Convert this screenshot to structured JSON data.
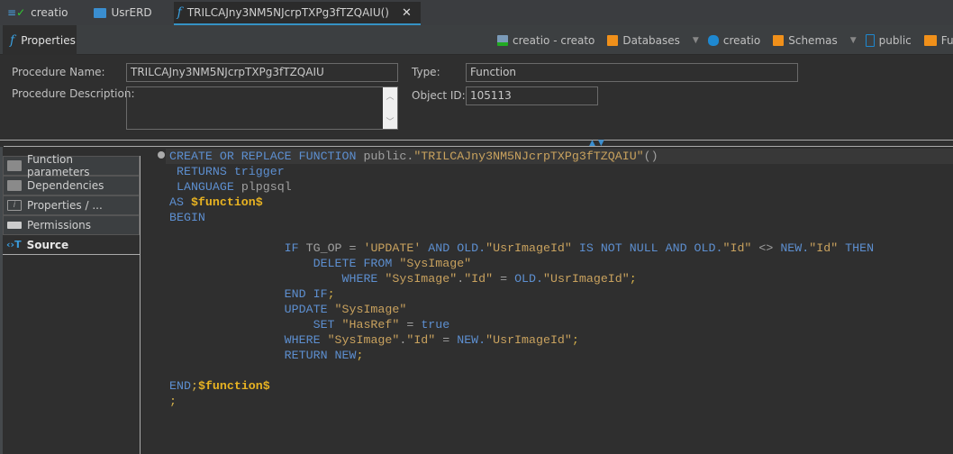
{
  "tabs": [
    {
      "label": "creatio",
      "icon": "connection-check-icon"
    },
    {
      "label": "UsrERD",
      "icon": "erd-icon"
    },
    {
      "label": "TRILCAJny3NM5NJcrpTXPg3fTZQAIU()",
      "icon": "function-icon",
      "active": true
    }
  ],
  "toolbar": {
    "properties_tab": "Properties",
    "breadcrumbs": [
      {
        "label": "creatio - creato",
        "icon": "postgres-connection-icon"
      },
      {
        "label": "Databases",
        "icon": "folder-db-icon",
        "dropdown": true
      },
      {
        "label": "creatio",
        "icon": "database-icon"
      },
      {
        "label": "Schemas",
        "icon": "schemas-icon",
        "dropdown": true
      },
      {
        "label": "public",
        "icon": "schema-icon"
      },
      {
        "label": "Functions",
        "icon": "folder-icon"
      }
    ]
  },
  "form": {
    "name_label": "Procedure Name:",
    "name_value": "TRILCAJny3NM5NJcrpTXPg3fTZQAIU",
    "desc_label": "Procedure Description:",
    "desc_value": "",
    "type_label": "Type:",
    "type_value": "Function",
    "id_label": "Object ID:",
    "id_value": "105113"
  },
  "sidebar": {
    "items": [
      {
        "label": "Function parameters",
        "icon": "table-icon"
      },
      {
        "label": "Dependencies",
        "icon": "folder-icon"
      },
      {
        "label": "Properties / ...",
        "icon": "info-icon"
      },
      {
        "label": "Permissions",
        "icon": "key-icon"
      },
      {
        "label": "Source",
        "icon": "source-icon",
        "active": true
      }
    ]
  },
  "colors": {
    "keyword": "#5d8fd0",
    "string": "#c9a25e",
    "identifier": "#a0a0a0",
    "dollar_quote": "#e8b322",
    "accent": "#3592c4"
  },
  "source": [
    [
      [
        "kw",
        "CREATE OR REPLACE FUNCTION "
      ],
      [
        "pl",
        "public."
      ],
      [
        "str",
        "\"TRILCAJny3NM5NJcrpTXPg3fTZQAIU\""
      ],
      [
        "pl",
        "()"
      ]
    ],
    [
      [
        "pl",
        " "
      ],
      [
        "kw",
        "RETURNS trigger"
      ]
    ],
    [
      [
        "pl",
        " "
      ],
      [
        "kw",
        "LANGUAGE "
      ],
      [
        "pl",
        "plpgsql"
      ]
    ],
    [
      [
        "kw",
        "AS "
      ],
      [
        "fn",
        "$function$"
      ]
    ],
    [
      [
        "kw",
        "BEGIN"
      ]
    ],
    [],
    [
      [
        "pl",
        "                "
      ],
      [
        "kw",
        "IF "
      ],
      [
        "pl",
        "TG_OP = "
      ],
      [
        "str",
        "'UPDATE'"
      ],
      [
        "kw",
        " AND OLD."
      ],
      [
        "str",
        "\"UsrImageId\""
      ],
      [
        "kw",
        " IS NOT NULL AND OLD."
      ],
      [
        "str",
        "\"Id\""
      ],
      [
        "pl",
        " <> "
      ],
      [
        "kw",
        "NEW."
      ],
      [
        "str",
        "\"Id\""
      ],
      [
        "kw",
        " THEN"
      ]
    ],
    [
      [
        "pl",
        "                    "
      ],
      [
        "kw",
        "DELETE FROM "
      ],
      [
        "str",
        "\"SysImage\""
      ]
    ],
    [
      [
        "pl",
        "                        "
      ],
      [
        "kw",
        "WHERE "
      ],
      [
        "str",
        "\"SysImage\""
      ],
      [
        "pl",
        "."
      ],
      [
        "str",
        "\"Id\""
      ],
      [
        "pl",
        " = "
      ],
      [
        "kw",
        "OLD."
      ],
      [
        "str",
        "\"UsrImageId\""
      ],
      [
        "pn",
        ";"
      ]
    ],
    [
      [
        "pl",
        "                "
      ],
      [
        "kw",
        "END IF"
      ],
      [
        "pn",
        ";"
      ]
    ],
    [
      [
        "pl",
        "                "
      ],
      [
        "kw",
        "UPDATE "
      ],
      [
        "str",
        "\"SysImage\""
      ]
    ],
    [
      [
        "pl",
        "                    "
      ],
      [
        "kw",
        "SET "
      ],
      [
        "str",
        "\"HasRef\""
      ],
      [
        "pl",
        " = "
      ],
      [
        "kw",
        "true"
      ]
    ],
    [
      [
        "pl",
        "                "
      ],
      [
        "kw",
        "WHERE "
      ],
      [
        "str",
        "\"SysImage\""
      ],
      [
        "pl",
        "."
      ],
      [
        "str",
        "\"Id\""
      ],
      [
        "pl",
        " = "
      ],
      [
        "kw",
        "NEW."
      ],
      [
        "str",
        "\"UsrImageId\""
      ],
      [
        "pn",
        ";"
      ]
    ],
    [
      [
        "pl",
        "                "
      ],
      [
        "kw",
        "RETURN NEW"
      ],
      [
        "pn",
        ";"
      ]
    ],
    [],
    [
      [
        "kw",
        "END"
      ],
      [
        "pn",
        ";"
      ],
      [
        "fn",
        "$function$"
      ]
    ],
    [
      [
        "pn",
        ";"
      ]
    ]
  ]
}
